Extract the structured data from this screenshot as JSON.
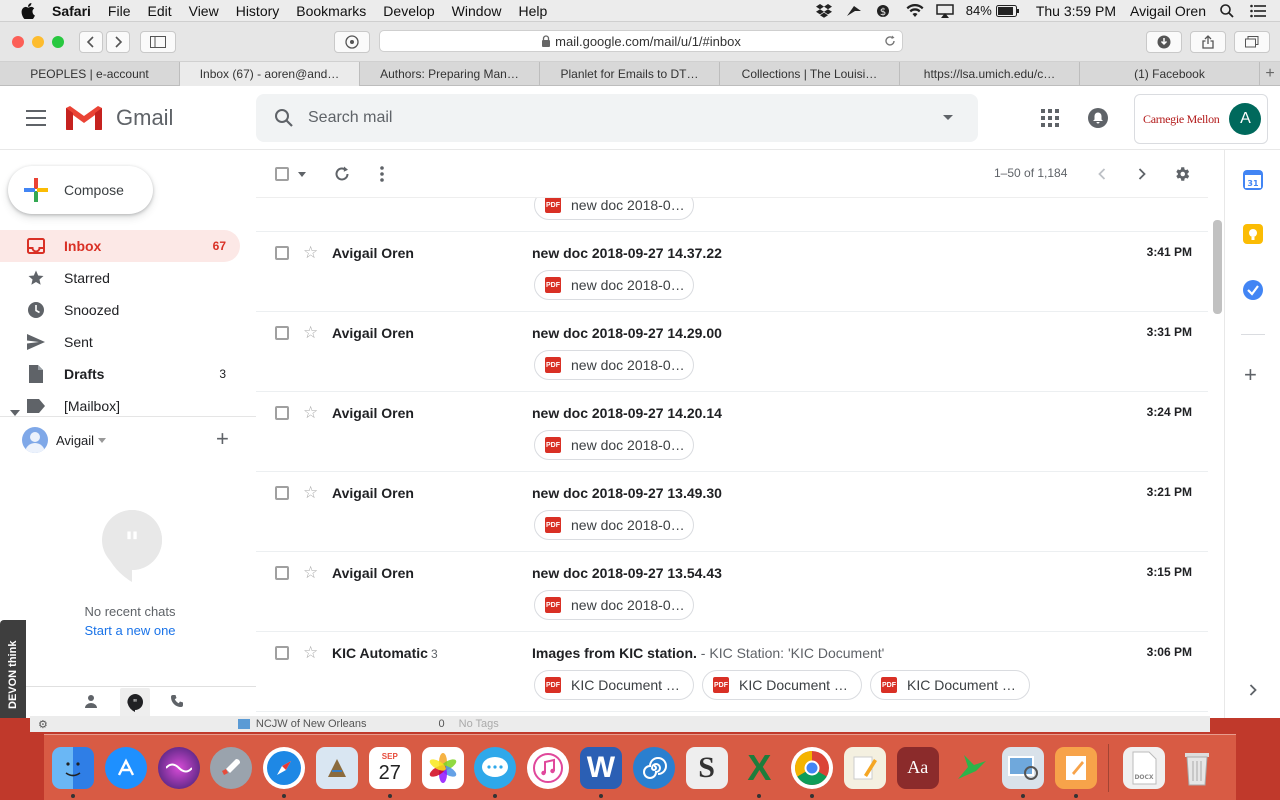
{
  "menubar": {
    "app": "Safari",
    "items": [
      "File",
      "Edit",
      "View",
      "History",
      "Bookmarks",
      "Develop",
      "Window",
      "Help"
    ],
    "battery": "84%",
    "clock": "Thu 3:59 PM",
    "user": "Avigail Oren"
  },
  "browser": {
    "url": "mail.google.com/mail/u/1/#inbox",
    "tabs": [
      "PEOPLES | e-account",
      "Inbox (67) - aoren@and…",
      "Authors: Preparing Man…",
      "Planlet for Emails to DT…",
      "Collections | The Louisi…",
      "https://lsa.umich.edu/c…",
      "(1) Facebook"
    ]
  },
  "gmail": {
    "logo_text": "Gmail",
    "search_placeholder": "Search mail",
    "account_org": "Carnegie Mellon",
    "avatar_letter": "A",
    "compose": "Compose",
    "nav": [
      {
        "label": "Inbox",
        "count": "67"
      },
      {
        "label": "Starred",
        "count": ""
      },
      {
        "label": "Snoozed",
        "count": ""
      },
      {
        "label": "Sent",
        "count": ""
      },
      {
        "label": "Drafts",
        "count": "3"
      },
      {
        "label": "[Mailbox]",
        "count": ""
      }
    ],
    "hangouts_user": "Avigail",
    "no_recent_chats": "No recent chats",
    "start_new": "Start a new one",
    "pager": "1–50 of 1,184",
    "devon_label": "DEVON think",
    "partial_chip": "new doc 2018-0…",
    "emails": [
      {
        "sender": "Avigail Oren",
        "count": "",
        "subject": "new doc 2018-09-27 14.37.22",
        "snippet": "",
        "time": "3:41 PM",
        "attachments": [
          "new doc 2018-0…"
        ]
      },
      {
        "sender": "Avigail Oren",
        "count": "",
        "subject": "new doc 2018-09-27 14.29.00",
        "snippet": "",
        "time": "3:31 PM",
        "attachments": [
          "new doc 2018-0…"
        ]
      },
      {
        "sender": "Avigail Oren",
        "count": "",
        "subject": "new doc 2018-09-27 14.20.14",
        "snippet": "",
        "time": "3:24 PM",
        "attachments": [
          "new doc 2018-0…"
        ]
      },
      {
        "sender": "Avigail Oren",
        "count": "",
        "subject": "new doc 2018-09-27 13.49.30",
        "snippet": "",
        "time": "3:21 PM",
        "attachments": [
          "new doc 2018-0…"
        ]
      },
      {
        "sender": "Avigail Oren",
        "count": "",
        "subject": "new doc 2018-09-27 13.54.43",
        "snippet": "",
        "time": "3:15 PM",
        "attachments": [
          "new doc 2018-0…"
        ]
      },
      {
        "sender": "KIC Automatic",
        "count": "3",
        "subject": "Images from KIC station.",
        "snippet": " - KIC Station: 'KIC Document'",
        "time": "3:06 PM",
        "attachments": [
          "KIC Document …",
          "KIC Document …",
          "KIC Document …"
        ]
      }
    ]
  },
  "desktop": {
    "finder_row": "NCJW of New Orleans",
    "finder_count": "0",
    "finder_tags": "No Tags",
    "calendar_month": "SEP",
    "calendar_day": "27"
  },
  "colors": {
    "gmail_red": "#d93025",
    "inbox_bg": "#fce8e6",
    "account_avatar": "#00695c",
    "cmu_red": "#b31b1b"
  }
}
